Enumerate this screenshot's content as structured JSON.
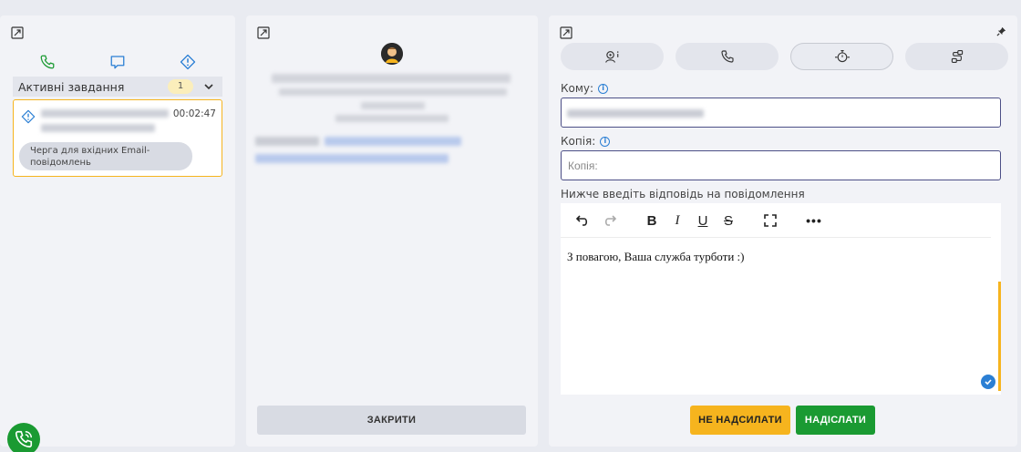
{
  "left": {
    "tabs": [
      {
        "icon": "phone-icon",
        "active": false
      },
      {
        "icon": "chat-icon",
        "active": false
      },
      {
        "icon": "alert-icon",
        "active": true
      }
    ],
    "section_title": "Активні завдання",
    "active_count": "1",
    "task": {
      "time": "00:02:47",
      "queue": "Черга для вхідних Email-повідомлень"
    }
  },
  "middle": {
    "close_label": "ЗАКРИТИ"
  },
  "right": {
    "to_label": "Кому:",
    "cc_label": "Копія:",
    "cc_placeholder": "Копія:",
    "reply_label": "Нижче введіть відповідь на повідомлення",
    "editor_text": "З повагою, Ваша служба турботи :)",
    "skip_label": "НЕ НАДСИЛАТИ",
    "send_label": "НАДІСЛАТИ"
  },
  "colors": {
    "accent": "#f6b41e",
    "success": "#1a9a32",
    "link": "#2b7fd4",
    "field_border": "#4c4f86"
  }
}
